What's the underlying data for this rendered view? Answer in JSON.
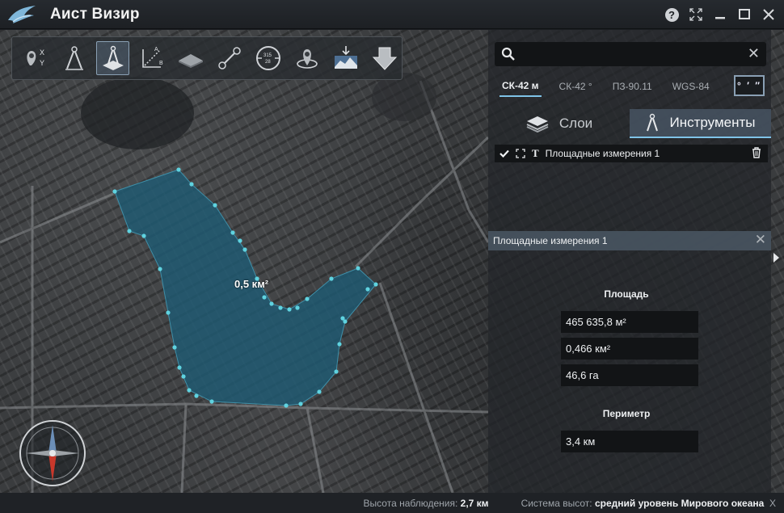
{
  "window": {
    "title": "Аист Визир",
    "help_label": "?",
    "minimize_label": "—",
    "close_label": "✕"
  },
  "toolbar": {
    "tools": [
      {
        "name": "coordinates-xy-icon",
        "label_x": "X",
        "label_y": "Y"
      },
      {
        "name": "compass-measure-icon"
      },
      {
        "name": "area-measure-icon",
        "active": true
      },
      {
        "name": "distance-measure-icon",
        "label_a": "A",
        "label_b": "B"
      },
      {
        "name": "terrain-layer-icon"
      },
      {
        "name": "line-route-icon"
      },
      {
        "name": "azimuth-dial-icon",
        "label": "315 28"
      },
      {
        "name": "globe-pin-icon"
      },
      {
        "name": "elevation-profile-icon"
      },
      {
        "name": "download-arrow-icon"
      }
    ]
  },
  "search": {
    "placeholder": "",
    "value": ""
  },
  "coord_systems": {
    "tabs": [
      "СК-42 м",
      "СК-42 °",
      "ПЗ-90.11",
      "WGS-84"
    ],
    "selected": "СК-42 м",
    "format_button": "° ′ ″"
  },
  "main_tabs": {
    "layers": "Слои",
    "tools": "Инструменты",
    "selected": "Инструменты"
  },
  "measurements": {
    "items": [
      {
        "name": "Площадные измерения 1",
        "visible": true,
        "text_icon": "T"
      }
    ]
  },
  "details": {
    "title": "Площадные измерения 1",
    "area_label": "Площадь",
    "area_m2": "465 635,8 м²",
    "area_km2": "0,466 км²",
    "area_ha": "46,6 га",
    "perimeter_label": "Периметр",
    "perimeter": "3,4 км"
  },
  "map": {
    "polygon_label": "0,5 км²",
    "polygon_fill": "#1f5a73",
    "vertex_color": "#5fd3e0"
  },
  "statusbar": {
    "altitude_label": "Высота наблюдения:",
    "altitude_value": "2,7 км",
    "height_system_label": "Система высот:",
    "height_system_value": "средний уровень Мирового океана",
    "trailing": "Х"
  },
  "colors": {
    "accent": "#7fc3e8",
    "titlebar": "#262a2f",
    "panel": "#222529"
  }
}
